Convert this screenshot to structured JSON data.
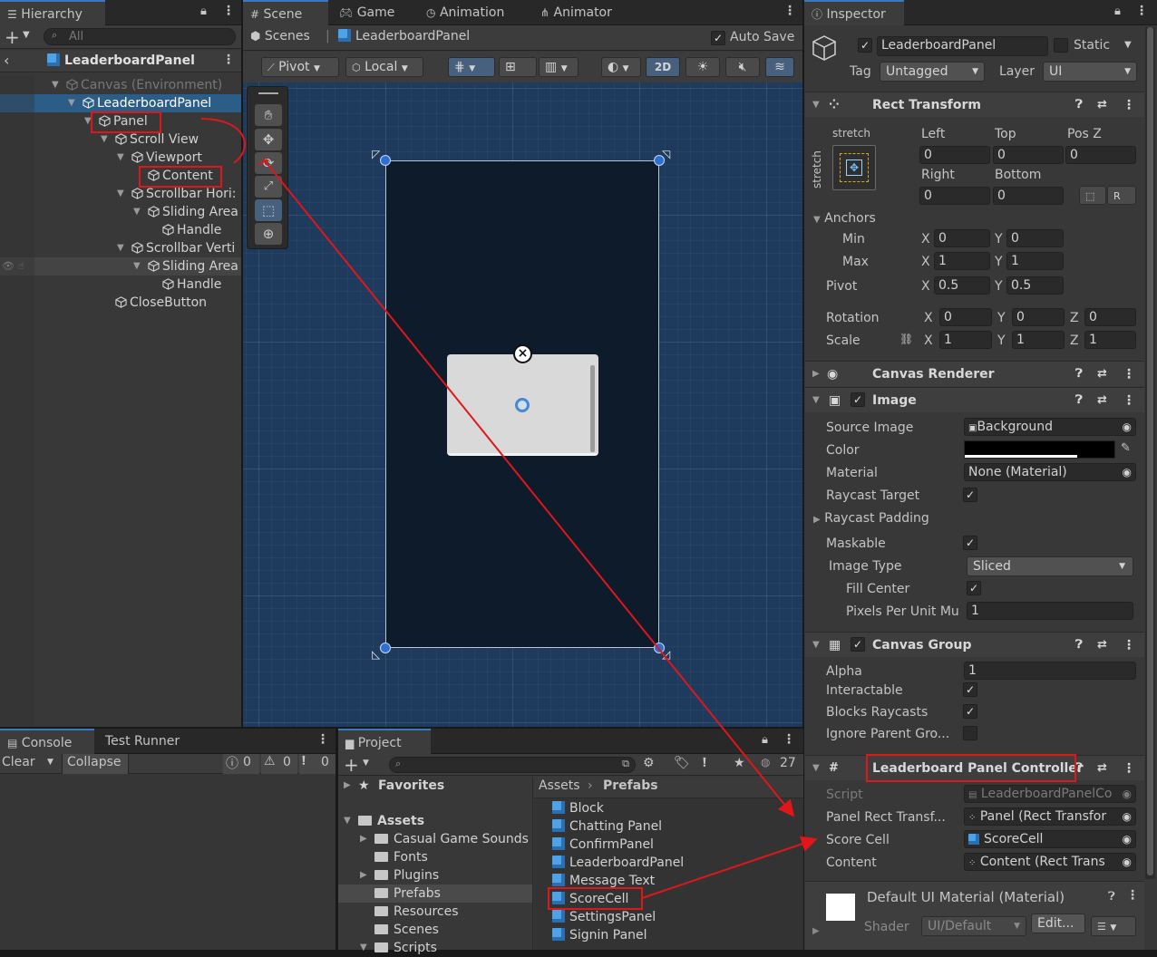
{
  "hierarchy": {
    "tab": "Hierarchy",
    "search_placeholder": "All",
    "root": "LeaderboardPanel",
    "items": [
      "Canvas (Environment)",
      "LeaderboardPanel",
      "Panel",
      "Scroll View",
      "Viewport",
      "Content",
      "Scrollbar Hori:",
      "Sliding Area",
      "Handle",
      "Scrollbar Verti",
      "Sliding Area",
      "Handle",
      "CloseButton"
    ]
  },
  "scene": {
    "tabs": [
      "Scene",
      "Game",
      "Animation",
      "Animator"
    ],
    "breadcrumb_root": "Scenes",
    "breadcrumb_item": "LeaderboardPanel",
    "auto_save": "Auto Save",
    "pivot": "Pivot",
    "local": "Local",
    "mode_2d": "2D"
  },
  "inspector": {
    "tab": "Inspector",
    "object_name": "LeaderboardPanel",
    "static_label": "Static",
    "tag_label": "Tag",
    "tag_value": "Untagged",
    "layer_label": "Layer",
    "layer_value": "UI",
    "rect_transform": {
      "title": "Rect Transform",
      "stretch_top": "stretch",
      "stretch_side": "stretch",
      "left_label": "Left",
      "left": "0",
      "top_label": "Top",
      "top": "0",
      "posz_label": "Pos Z",
      "posz": "0",
      "right_label": "Right",
      "right": "0",
      "bottom_label": "Bottom",
      "bottom": "0",
      "anchors": "Anchors",
      "min": "Min",
      "min_x": "0",
      "min_y": "0",
      "max": "Max",
      "max_x": "1",
      "max_y": "1",
      "pivot": "Pivot",
      "pivot_x": "0.5",
      "pivot_y": "0.5",
      "rotation": "Rotation",
      "rot_x": "0",
      "rot_y": "0",
      "rot_z": "0",
      "scale": "Scale",
      "scale_x": "1",
      "scale_y": "1",
      "scale_z": "1",
      "x": "X",
      "y": "Y",
      "z": "Z"
    },
    "canvas_renderer": "Canvas Renderer",
    "image": {
      "title": "Image",
      "source_image_label": "Source Image",
      "source_image": "Background",
      "color_label": "Color",
      "material_label": "Material",
      "material": "None (Material)",
      "raycast_target": "Raycast Target",
      "raycast_padding": "Raycast Padding",
      "maskable": "Maskable",
      "image_type_label": "Image Type",
      "image_type": "Sliced",
      "fill_center": "Fill Center",
      "ppu_label": "Pixels Per Unit Mu",
      "ppu": "1"
    },
    "canvas_group": {
      "title": "Canvas Group",
      "alpha_label": "Alpha",
      "alpha": "1",
      "interactable": "Interactable",
      "blocks_raycasts": "Blocks Raycasts",
      "ignore_parent": "Ignore Parent Gro..."
    },
    "controller": {
      "title": "Leaderboard Panel Controller",
      "script_label": "Script",
      "script": "LeaderboardPanelCo",
      "panel_rect_label": "Panel Rect Transf...",
      "panel_rect": "Panel (Rect Transfor",
      "score_cell_label": "Score Cell",
      "score_cell": "ScoreCell",
      "content_label": "Content",
      "content": "Content (Rect Trans"
    },
    "material": {
      "title": "Default UI Material (Material)",
      "shader_label": "Shader",
      "shader": "UI/Default",
      "edit": "Edit..."
    }
  },
  "console": {
    "tabs": [
      "Console",
      "Test Runner"
    ],
    "clear": "Clear",
    "collapse": "Collapse",
    "counts": [
      "0",
      "0",
      "0"
    ]
  },
  "project": {
    "tab": "Project",
    "favorites": "Favorites",
    "assets": "Assets",
    "folders": [
      "Casual Game Sounds",
      "Fonts",
      "Plugins",
      "Prefabs",
      "Resources",
      "Scenes",
      "Scripts"
    ],
    "hidden_count": "27",
    "breadcrumb_root": "Assets",
    "breadcrumb_item": "Prefabs",
    "prefabs": [
      "Block",
      "Chatting Panel",
      "ConfirmPanel",
      "LeaderboardPanel",
      "Message Text",
      "ScoreCell",
      "SettingsPanel",
      "Signin Panel"
    ]
  },
  "colors": {
    "accent": "#3a79bb",
    "annotation": "#e0161b",
    "selection": "#2c5d87",
    "scene_bg": "#1e3a5c"
  }
}
